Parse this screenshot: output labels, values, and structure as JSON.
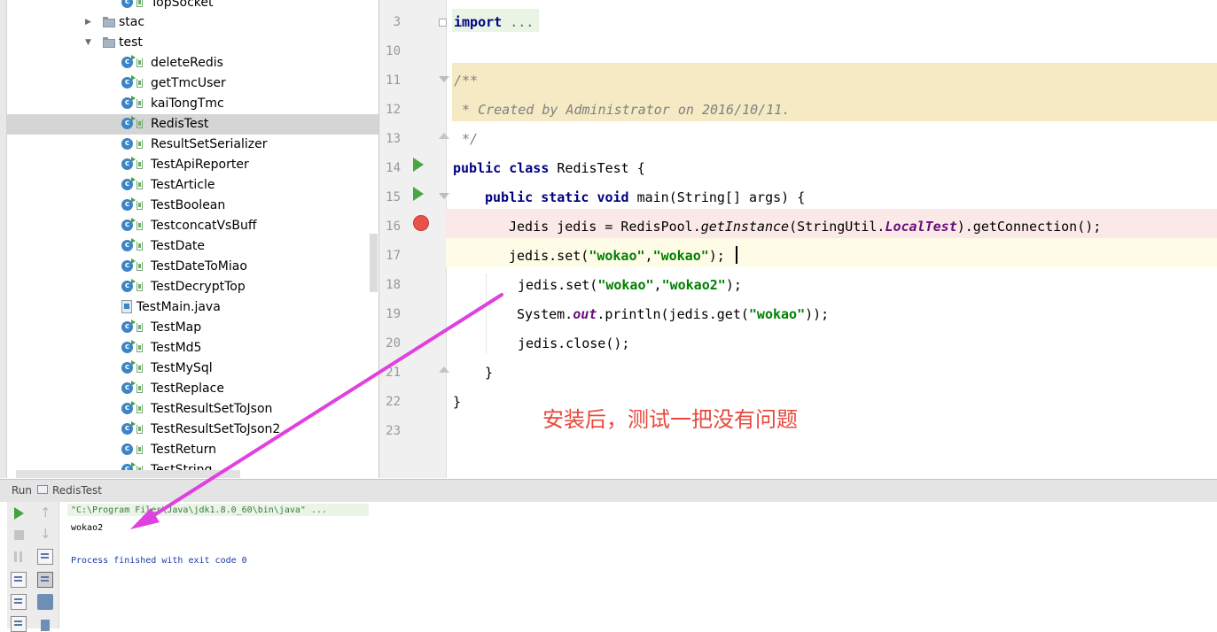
{
  "project_tree": {
    "items": [
      {
        "label": "TopSocket",
        "type": "class"
      },
      {
        "label": "stac",
        "type": "folder",
        "expanded": false
      },
      {
        "label": "test",
        "type": "folder",
        "expanded": true
      },
      {
        "label": "deleteRedis",
        "type": "runnable-class"
      },
      {
        "label": "getTmcUser",
        "type": "runnable-class"
      },
      {
        "label": "kaiTongTmc",
        "type": "runnable-class"
      },
      {
        "label": "RedisTest",
        "type": "runnable-class",
        "selected": true
      },
      {
        "label": "ResultSetSerializer",
        "type": "class"
      },
      {
        "label": "TestApiReporter",
        "type": "runnable-class"
      },
      {
        "label": "TestArticle",
        "type": "runnable-class"
      },
      {
        "label": "TestBoolean",
        "type": "runnable-class"
      },
      {
        "label": "TestconcatVsBuff",
        "type": "runnable-class"
      },
      {
        "label": "TestDate",
        "type": "runnable-class"
      },
      {
        "label": "TestDateToMiao",
        "type": "runnable-class"
      },
      {
        "label": "TestDecryptTop",
        "type": "runnable-class"
      },
      {
        "label": "TestMain.java",
        "type": "java-file"
      },
      {
        "label": "TestMap",
        "type": "runnable-class"
      },
      {
        "label": "TestMd5",
        "type": "runnable-class"
      },
      {
        "label": "TestMySql",
        "type": "runnable-class"
      },
      {
        "label": "TestReplace",
        "type": "runnable-class"
      },
      {
        "label": "TestResultSetToJson",
        "type": "runnable-class"
      },
      {
        "label": "TestResultSetToJson2",
        "type": "runnable-class"
      },
      {
        "label": "TestReturn",
        "type": "class"
      },
      {
        "label": "TestString",
        "type": "runnable-class"
      }
    ]
  },
  "editor": {
    "line_numbers": [
      "3",
      "10",
      "11",
      "12",
      "13",
      "14",
      "15",
      "16",
      "17",
      "18",
      "19",
      "20",
      "21",
      "22",
      "23"
    ],
    "code": {
      "l3": {
        "kw": "import",
        "rest": " ..."
      },
      "l11": "/**",
      "l12": " * Created by Administrator on 2016/10/11.",
      "l13": " */",
      "l14": {
        "kw1": "public",
        "kw2": "class",
        "rest": " RedisTest {"
      },
      "l15": {
        "kw1": "public",
        "kw2": "static",
        "kw3": "void",
        "rest": " main(String[] args) {"
      },
      "l16": {
        "a": "Jedis jedis = RedisPool.",
        "b": "getInstance",
        "c": "(StringUtil.",
        "d": "LocalTest",
        "e": ").getConnection();"
      },
      "l17": {
        "a": "jedis.set(",
        "s1": "\"wokao\"",
        "comma": ",",
        "s2": "\"wokao\"",
        "e": ");"
      },
      "l18": {
        "a": "jedis.set(",
        "s1": "\"wokao\"",
        "comma": ",",
        "s2": "\"wokao2\"",
        "e": ");"
      },
      "l19": {
        "a": "System.",
        "b": "out",
        "c": ".println(jedis.get(",
        "s1": "\"wokao\"",
        "e": "));"
      },
      "l20": "jedis.close();",
      "l21": "}",
      "l22": "}"
    },
    "annotation": "安装后，测试一把没有问题"
  },
  "run_panel": {
    "label": "Run",
    "tab": "RedisTest",
    "console": {
      "command": "\"C:\\Program Files\\Java\\jdk1.8.0_60\\bin\\java\" ...",
      "output": "wokao2",
      "finished": "Process finished with exit code 0"
    }
  },
  "colors": {
    "keyword": "#000080",
    "string": "#008000",
    "doc_comment_bg": "#f5eac3",
    "breakpoint": "#e8524a",
    "annotation": "#e8483c",
    "arrow": "#e040e0"
  }
}
